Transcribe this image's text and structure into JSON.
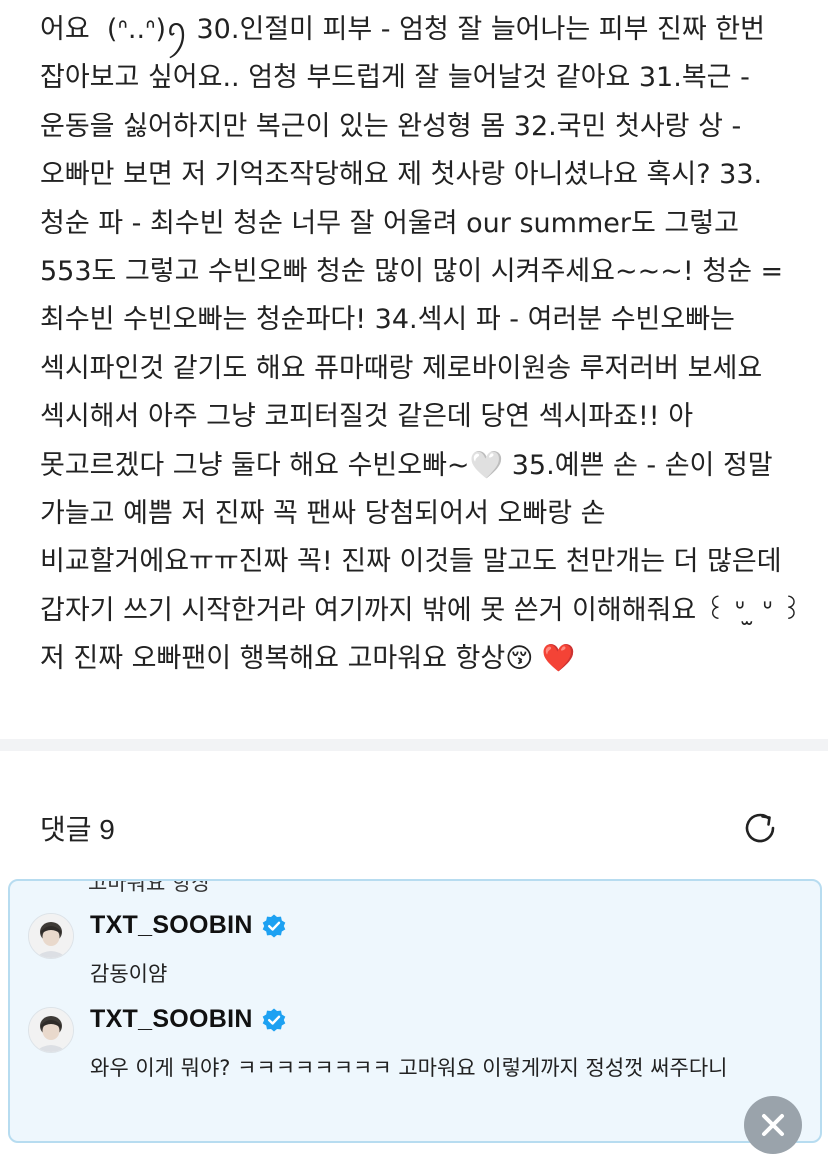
{
  "post": {
    "body": "어요  (ᐢ..ᐢ)ꪆ 30.인절미 피부 - 엄청 잘 늘어나는 피부 진짜 한번 잡아보고 싶어요.. 엄청 부드럽게 잘 늘어날것 같아요 31.복근 - 운동을 싫어하지만 복근이 있는 완성형 몸 32.국민 첫사랑 상 - 오빠만 보면 저 기억조작당해요 제 첫사랑 아니셨나요 혹시? 33.청순 파 - 최수빈 청순 너무 잘 어울려 our summer도 그렇고 553도 그렇고 수빈오빠 청순 많이 많이 시켜주세요~~~! 청순 = 최수빈 수빈오빠는 청순파다! 34.섹시 파 - 여러분 수빈오빠는 섹시파인것 같기도 해요 퓨마때랑 제로바이원송 루저러버 보세요 섹시해서 아주 그냥 코피터질것 같은데 당연 섹시파죠!! 아 못고르겠다 그냥 둘다 해요 수빈오빠~🤍 35.예쁜 손 - 손이 정말 가늘고 예쁨 저 진짜 꼭 팬싸 당첨되어서 오빠랑 손 비교할거에요ㅠㅠ진짜 꼭! 진짜 이것들 말고도 천만개는 더 많은데 갑자기 쓰기 시작한거라 여기까지 밖에 못 쓴거 이해해줘요 ꒰ ᐡ ̫ ᐡ ꒱ 저 진짜 오빠팬이 행복해요 고마워요 항상😚 ❤️"
  },
  "comments_section": {
    "title": "댓글 9",
    "clipped_previous_text": "고마워요 항상",
    "comments": [
      {
        "author": "TXT_SOOBIN",
        "verified": true,
        "text": "감동이얌"
      },
      {
        "author": "TXT_SOOBIN",
        "verified": true,
        "text": "와우 이게 뭐야? ㅋㅋㅋㅋㅋㅋㅋㅋ 고마워요 이렇게까지 정성껏 써주다니"
      }
    ]
  },
  "icons": {
    "refresh": "refresh-icon",
    "verified": "verified-badge-icon",
    "close": "close-icon",
    "avatar": "avatar-photo"
  },
  "colors": {
    "panel_bg": "#eef7fd",
    "panel_border": "#b7dcf0",
    "verified_blue": "#1da1f2",
    "divider": "#f2f3f5"
  }
}
